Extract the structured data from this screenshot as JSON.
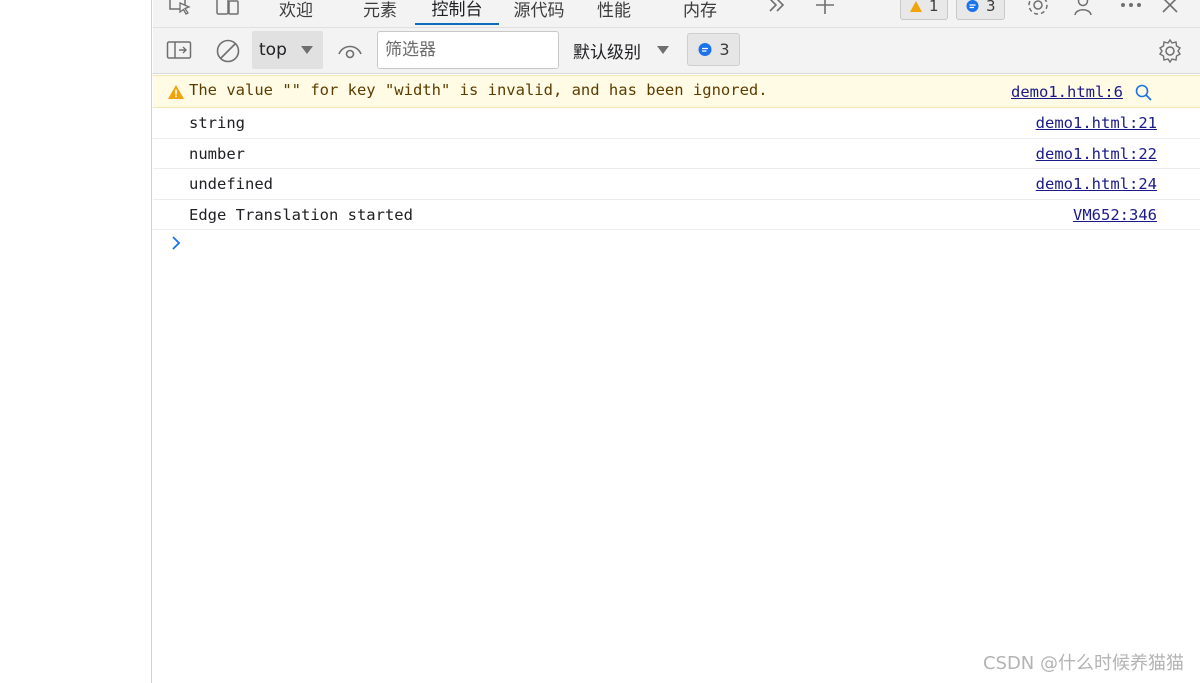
{
  "tabs": [
    {
      "label": "欢迎"
    },
    {
      "label": "元素"
    },
    {
      "label": "控制台"
    },
    {
      "label": "源代码"
    },
    {
      "label": "性能"
    },
    {
      "label": "内存"
    }
  ],
  "active_tab": "控制台",
  "issues": {
    "warnings": "1",
    "messages": "3"
  },
  "toolbar": {
    "context": "top",
    "filter_placeholder": "筛选器",
    "levels": "默认级别",
    "message_count": "3"
  },
  "console": {
    "warning": {
      "text": "The value \"\" for key \"width\" is invalid, and has been ignored.",
      "source": "demo1.html:6"
    },
    "logs": [
      {
        "text": "string",
        "source": "demo1.html:21"
      },
      {
        "text": "number",
        "source": "demo1.html:22"
      },
      {
        "text": "undefined",
        "source": "demo1.html:24"
      },
      {
        "text": "Edge Translation started",
        "source": "VM652:346"
      }
    ]
  },
  "watermark": "CSDN @什么时候养猫猫",
  "colors": {
    "accent": "#0f6cbd",
    "warning_bg": "#fffbe5",
    "warning_icon": "#f0a30a",
    "message_icon": "#1a73e8"
  }
}
